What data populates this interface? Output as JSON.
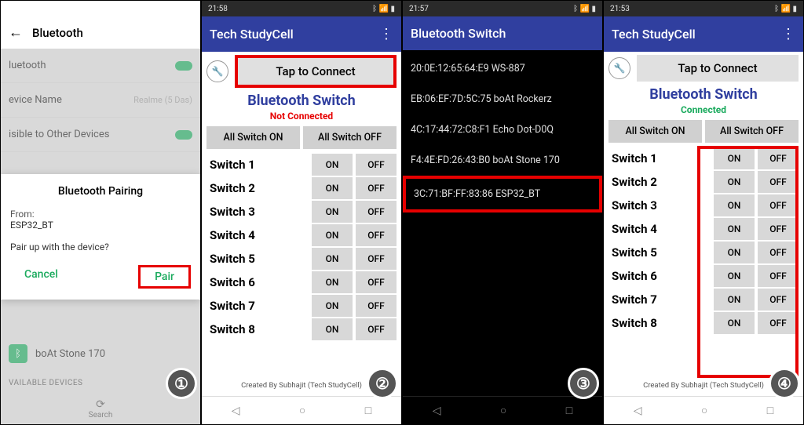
{
  "steps": [
    "①",
    "②",
    "③",
    "④"
  ],
  "phone1": {
    "settings_title": "Bluetooth",
    "rows": {
      "bluetooth": "luetooth",
      "device_name": "evice Name",
      "device_val": "Realme (5 Das)",
      "visible": "isible to Other Devices"
    },
    "dialog": {
      "title": "Bluetooth Pairing",
      "from_label": "From:",
      "from_value": "ESP32_BT",
      "prompt": "Pair up with the device?",
      "cancel": "Cancel",
      "pair": "Pair"
    },
    "paired_device": "boAt Stone 170",
    "avail_label": "VAILABLE DEVICES",
    "search": "Search"
  },
  "common_app": {
    "header": "Tech StudyCell",
    "tap_connect": "Tap to Connect",
    "title": "Bluetooth Switch",
    "all_on": "All Switch ON",
    "all_off": "All Switch OFF",
    "switches": [
      "Switch 1",
      "Switch 2",
      "Switch 3",
      "Switch 4",
      "Switch 5",
      "Switch 6",
      "Switch 7",
      "Switch 8"
    ],
    "on": "ON",
    "off": "OFF",
    "credit": "Created By Subhajit (Tech StudyCell)"
  },
  "phone2": {
    "time": "21:58",
    "status": "Not Connected"
  },
  "phone3": {
    "time": "21:57",
    "header": "Bluetooth Switch",
    "devices": [
      "20:0E:12:65:64:E9 WS-887",
      "EB:06:EF:7D:5C:75 boAt Rockerz",
      "4C:17:44:72:C8:F1 Echo Dot-D0Q",
      "F4:4E:FD:26:43:B0 boAt Stone 170",
      "3C:71:BF:FF:83:86 ESP32_BT"
    ]
  },
  "phone4": {
    "time": "21:53",
    "status": "Connected"
  }
}
